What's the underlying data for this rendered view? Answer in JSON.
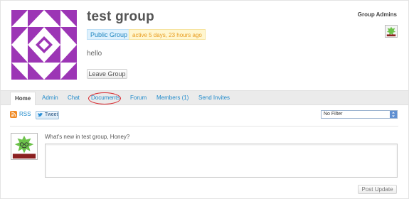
{
  "group": {
    "name": "test group",
    "type_badge": "Public Group",
    "activity": "active 5 days, 23 hours ago",
    "description": "hello",
    "leave_button": "Leave Group"
  },
  "admins": {
    "title": "Group Admins"
  },
  "tabs": [
    {
      "label": "Home",
      "active": true
    },
    {
      "label": "Admin"
    },
    {
      "label": "Chat"
    },
    {
      "label": "Documents"
    },
    {
      "label": "Forum"
    },
    {
      "label": "Members (1)"
    },
    {
      "label": "Send Invites"
    }
  ],
  "feed": {
    "rss_label": "RSS",
    "tweet_label": "Tweet",
    "filter_selected": "No Filter"
  },
  "post": {
    "prompt": "What's new in test group, Honey?",
    "textarea_value": "",
    "button": "Post Update"
  },
  "colors": {
    "link": "#1f8acb",
    "avatar_purple": "#9c35b5",
    "annotation_circle": "#d8292f"
  },
  "icons": {
    "rss": "rss-icon",
    "tweet": "twitter-bird-icon",
    "dropdown": "chevron-down-icon",
    "resize": "resize-handle-icon"
  }
}
